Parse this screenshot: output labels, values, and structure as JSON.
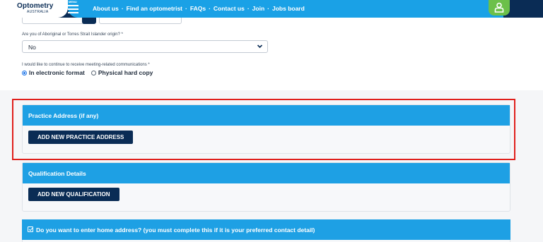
{
  "header": {
    "logo_main": "Optometry",
    "logo_sub": "AUSTRALIA",
    "menu_label": "MENU",
    "nav": [
      "About us",
      "Find an optometrist",
      "FAQs",
      "Contact us",
      "Join",
      "Jobs board"
    ],
    "separator": "·",
    "user_icon": "user-icon"
  },
  "form": {
    "origin_label": "Are you of Aboriginal or Torres Strait Islander origin? *",
    "origin_value": "No",
    "comm_label": "I would like to continue to receive meeting-related communications *",
    "comm_options": [
      {
        "label": "In electronic format",
        "checked": true
      },
      {
        "label": "Physical hard copy",
        "checked": false
      }
    ]
  },
  "sections": {
    "practice": {
      "title": "Practice Address (if any)",
      "button": "ADD NEW PRACTICE ADDRESS"
    },
    "qualification": {
      "title": "Qualification Details",
      "button": "ADD NEW QUALIFICATION"
    },
    "home": {
      "title": "Do you want to enter home address? (you must complete this if it is your preferred contact detail)",
      "checked": true
    }
  },
  "colors": {
    "navy": "#0a2c55",
    "sky": "#1ea0e4",
    "green": "#6cc04a",
    "highlight": "#e0201c"
  }
}
